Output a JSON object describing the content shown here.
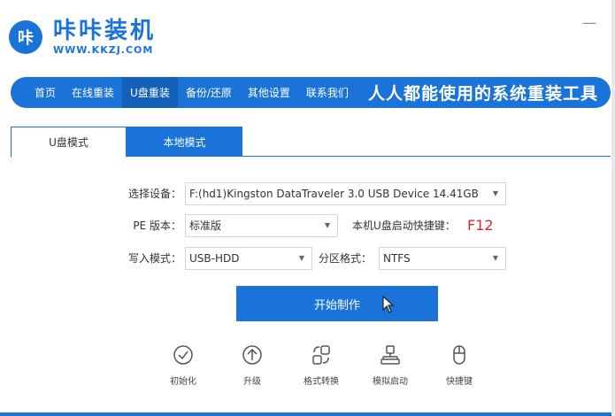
{
  "app": {
    "logo_badge": "咔",
    "title": "咔咔装机",
    "url": "WWW.KKZJ.COM",
    "minimize_label": "—"
  },
  "nav": {
    "items": [
      {
        "label": "首页"
      },
      {
        "label": "在线重装"
      },
      {
        "label": "U盘重装"
      },
      {
        "label": "备份/还原"
      },
      {
        "label": "其他设置"
      },
      {
        "label": "联系我们"
      }
    ],
    "active_index": 2,
    "slogan": "人人都能使用的系统重装工具"
  },
  "tabs": [
    {
      "label": "U盘模式"
    },
    {
      "label": "本地模式"
    }
  ],
  "form": {
    "device_label": "选择设备：",
    "device_value": "F:(hd1)Kingston DataTraveler 3.0 USB Device 14.41GB",
    "pe_label": "PE 版本：",
    "pe_value": "标准版",
    "hotkey_label": "本机U盘启动快捷键：",
    "hotkey_value": "F12",
    "write_label": "写入模式：",
    "write_value": "USB-HDD",
    "partition_label": "分区格式：",
    "partition_value": "NTFS",
    "start_button": "开始制作"
  },
  "tools": [
    {
      "label": "初始化",
      "icon": "check-circle-icon"
    },
    {
      "label": "升级",
      "icon": "arrow-up-circle-icon"
    },
    {
      "label": "格式转换",
      "icon": "format-convert-icon"
    },
    {
      "label": "模拟启动",
      "icon": "simulate-boot-icon"
    },
    {
      "label": "快捷键",
      "icon": "mouse-icon"
    }
  ],
  "colors": {
    "accent": "#1a73d8",
    "hotkey": "#e02424"
  }
}
